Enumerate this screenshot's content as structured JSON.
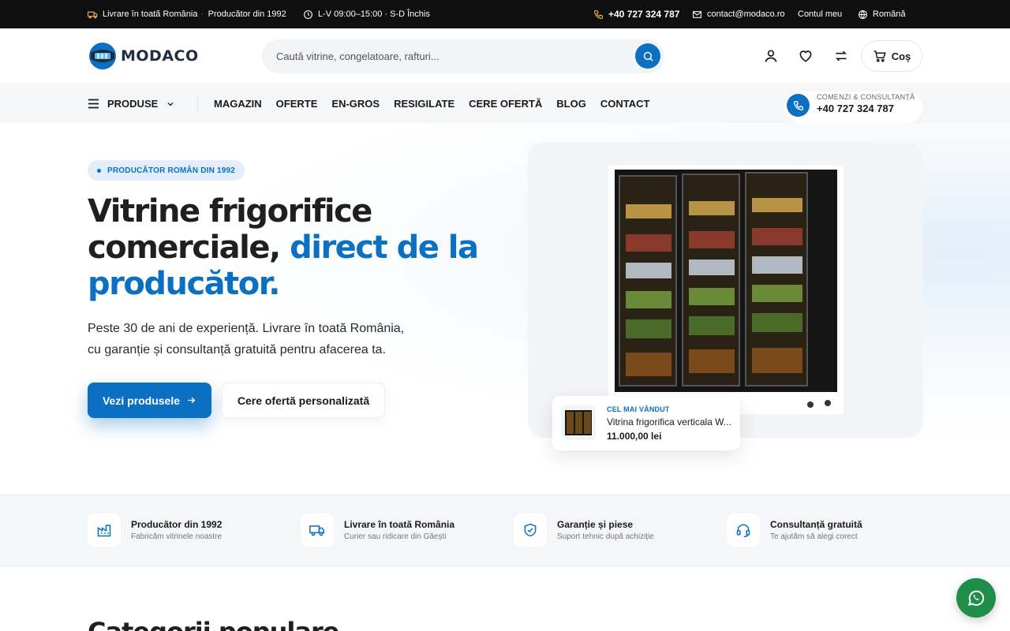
{
  "topbar": {
    "delivery": "Livrare în toată România",
    "producer": "Producător din 1992",
    "hours": "L-V 09:00–15:00 · S-D Închis",
    "phone": "+40 727 324 787",
    "email": "contact@modaco.ro",
    "account": "Contul meu",
    "language": "Română"
  },
  "header": {
    "logo_text": "MODACO",
    "search_placeholder": "Caută vitrine, congelatoare, rafturi...",
    "cart_label": "Coș"
  },
  "nav": {
    "products_label": "PRODUSE",
    "links": [
      "MAGAZIN",
      "OFERTE",
      "EN-GROS",
      "RESIGILATE",
      "CERE OFERTĂ",
      "BLOG",
      "CONTACT"
    ],
    "phone_label": "COMENZI & CONSULTANȚĂ",
    "phone_number": "+40 727 324 787"
  },
  "hero": {
    "badge": "PRODUCĂTOR ROMÂN DIN 1992",
    "title_line1": "Vitrine frigorifice",
    "title_line2_plain": "comerciale, ",
    "title_line2_accent": "direct de la",
    "title_line3_accent": "producător.",
    "subtitle_line1": "Peste 30 de ani de experiență. Livrare în toată România,",
    "subtitle_line2": "cu garanție și consultanță gratuită pentru afacerea ta.",
    "primary_button": "Vezi produsele",
    "secondary_button": "Cere ofertă personalizată"
  },
  "bestseller": {
    "label": "CEL MAI VÂNDUT",
    "name": "Vitrina frigorifica verticala W...",
    "price": "11.000,00 lei"
  },
  "features": [
    {
      "title": "Producător din 1992",
      "subtitle": "Fabricăm vitrinele noastre",
      "icon": "factory-icon"
    },
    {
      "title": "Livrare în toată România",
      "subtitle": "Curier sau ridicare din Găești",
      "icon": "truck-icon"
    },
    {
      "title": "Garanție și piese",
      "subtitle": "Suport tehnic după achiziție",
      "icon": "shield-check-icon"
    },
    {
      "title": "Consultanță gratuită",
      "subtitle": "Te ajutăm să alegi corect",
      "icon": "headset-icon"
    }
  ],
  "section_title": "Categorii populare",
  "colors": {
    "accent": "#0b6fc2",
    "topbar_bg": "#0f0f10",
    "whatsapp": "#1e8e48"
  }
}
